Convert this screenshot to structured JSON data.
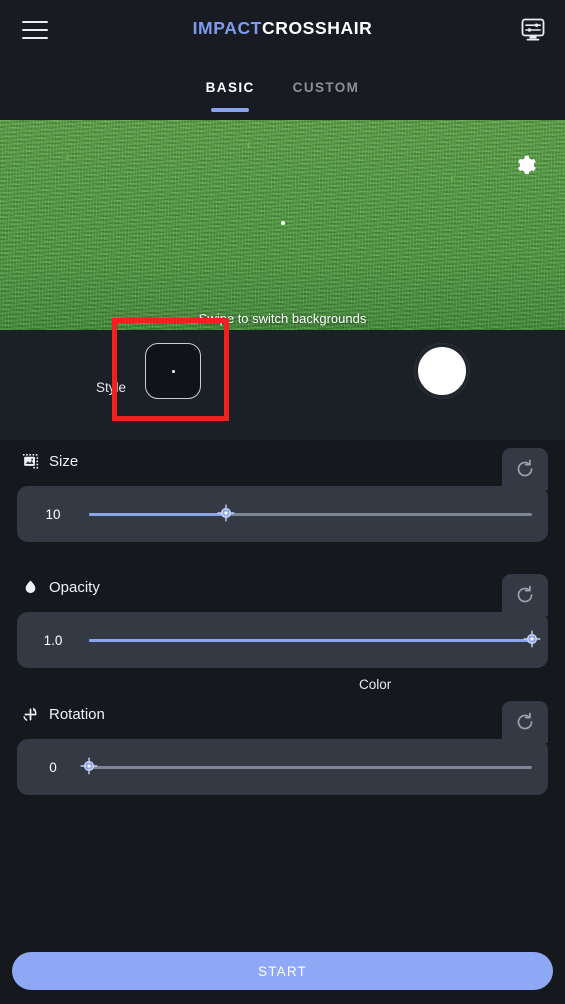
{
  "app": {
    "brand_prefix": "IMPACT",
    "brand_suffix": "CROSSHAIR",
    "accent_color": "#8ba4ef",
    "background_color": "#15191e",
    "panel_color": "#343a44",
    "highlight_color": "#ef2222"
  },
  "header": {
    "menu_icon": "hamburger-menu-icon",
    "display_settings_icon": "monitor-sliders-icon"
  },
  "tabs": [
    {
      "label": "BASIC",
      "active": true
    },
    {
      "label": "CUSTOM",
      "active": false
    }
  ],
  "preview": {
    "background_name": "grass-field",
    "settings_icon": "gear-icon",
    "hint": "Swipe to switch backgrounds",
    "crosshair_preview": "dot"
  },
  "style_row": {
    "style_label": "Style",
    "style_swatch_icon": "crosshair-dot-preview",
    "color_label": "Color",
    "color_value": "#ffffff",
    "highlighted_element": "style-swatch"
  },
  "controls": [
    {
      "id": "size",
      "title": "Size",
      "icon": "image-resize-icon",
      "value": "10",
      "fill_percent": 31,
      "reset_icon": "refresh-icon"
    },
    {
      "id": "opacity",
      "title": "Opacity",
      "icon": "droplet-icon",
      "value": "1.0",
      "fill_percent": 100,
      "reset_icon": "refresh-icon"
    },
    {
      "id": "rotation",
      "title": "Rotation",
      "icon": "rotate-crosshair-icon",
      "value": "0",
      "fill_percent": 0,
      "reset_icon": "refresh-icon"
    }
  ],
  "footer": {
    "start_label": "START"
  }
}
